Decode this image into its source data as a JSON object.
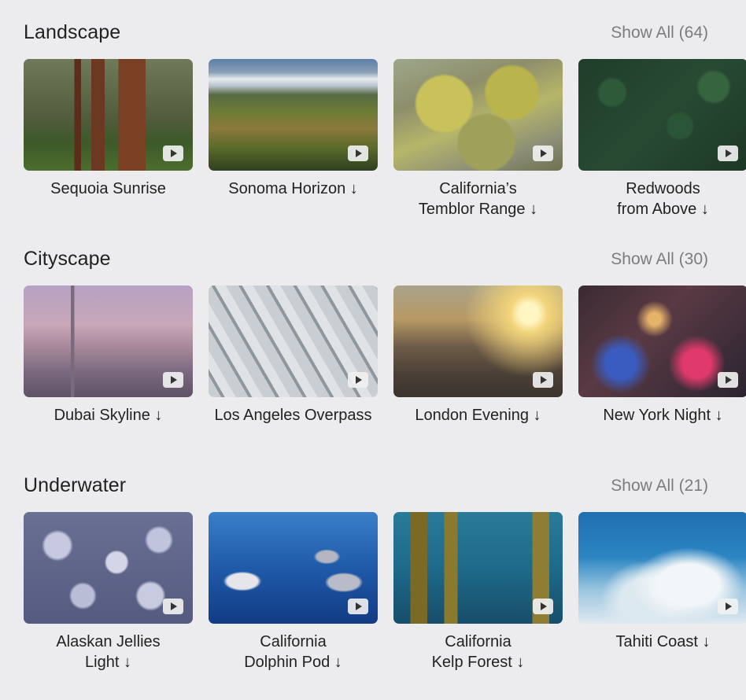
{
  "sections": [
    {
      "title": "Landscape",
      "show_all": "Show All (64)",
      "items": [
        {
          "caption": "Sequoia Sunrise"
        },
        {
          "caption": "Sonoma Horizon ↓"
        },
        {
          "caption": "California’s\nTemblor Range ↓"
        },
        {
          "caption": "Redwoods\nfrom Above ↓"
        }
      ]
    },
    {
      "title": "Cityscape",
      "show_all": "Show All (30)",
      "items": [
        {
          "caption": "Dubai Skyline ↓"
        },
        {
          "caption": "Los Angeles Overpass"
        },
        {
          "caption": "London Evening ↓"
        },
        {
          "caption": "New York Night ↓"
        }
      ]
    },
    {
      "title": "Underwater",
      "show_all": "Show All (21)",
      "items": [
        {
          "caption": "Alaskan Jellies\nLight ↓"
        },
        {
          "caption": "California\nDolphin Pod ↓"
        },
        {
          "caption": "California\nKelp Forest ↓"
        },
        {
          "caption": "Tahiti Coast ↓"
        }
      ]
    }
  ]
}
